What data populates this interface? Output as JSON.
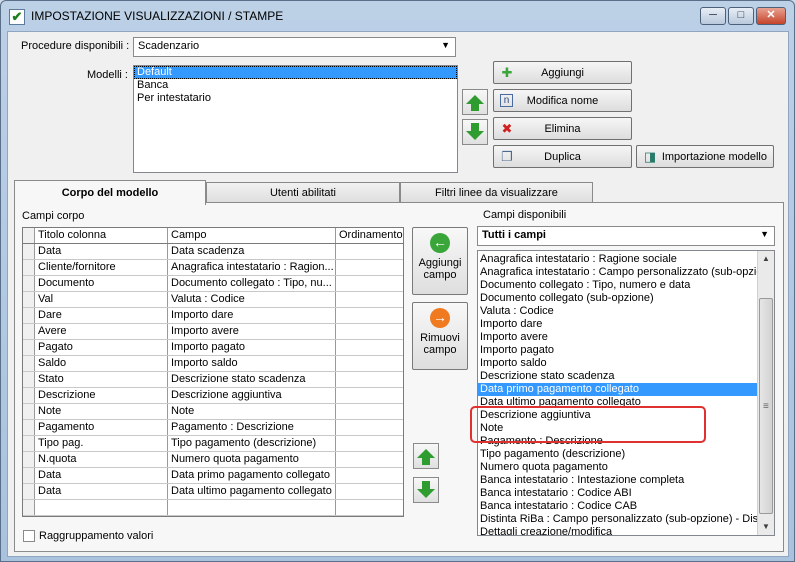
{
  "window": {
    "title": "IMPOSTAZIONE VISUALIZZAZIONI / STAMPE",
    "minimize": "─",
    "maximize": "□",
    "close": "✕"
  },
  "procedure": {
    "label": "Procedure disponibili :",
    "value": "Scadenzario"
  },
  "modelli": {
    "label": "Modelli :",
    "items": [
      "Default",
      "Banca",
      "Per intestatario"
    ],
    "selected_index": 0
  },
  "actions": {
    "aggiungi": "Aggiungi",
    "modifica_nome": "Modifica nome",
    "elimina": "Elimina",
    "duplica": "Duplica",
    "importazione": "Importazione modello"
  },
  "tabs": [
    "Corpo del modello",
    "Utenti abilitati",
    "Filtri linee da visualizzare"
  ],
  "active_tab_index": 0,
  "campi_corpo": {
    "label": "Campi corpo",
    "columns": [
      "Titolo colonna",
      "Campo",
      "Ordinamento"
    ],
    "rows": [
      [
        "Data",
        "Data scadenza",
        ""
      ],
      [
        "Cliente/fornitore",
        "Anagrafica intestatario : Ragion...",
        ""
      ],
      [
        "Documento",
        "Documento collegato : Tipo, nu...",
        ""
      ],
      [
        "Val",
        "Valuta : Codice",
        ""
      ],
      [
        "Dare",
        "Importo dare",
        ""
      ],
      [
        "Avere",
        "Importo avere",
        ""
      ],
      [
        "Pagato",
        "Importo pagato",
        ""
      ],
      [
        "Saldo",
        "Importo saldo",
        ""
      ],
      [
        "Stato",
        "Descrizione stato scadenza",
        ""
      ],
      [
        "Descrizione",
        "Descrizione aggiuntiva",
        ""
      ],
      [
        "Note",
        "Note",
        ""
      ],
      [
        "Pagamento",
        "Pagamento : Descrizione",
        ""
      ],
      [
        "Tipo pag.",
        "Tipo pagamento (descrizione)",
        ""
      ],
      [
        "N.quota",
        "Numero quota pagamento",
        ""
      ],
      [
        "Data",
        "Data primo pagamento collegato",
        ""
      ],
      [
        "Data",
        "Data ultimo pagamento collegato",
        ""
      ],
      [
        "",
        "",
        ""
      ]
    ]
  },
  "middle_buttons": {
    "aggiungi_campo": [
      "Aggiungi",
      "campo"
    ],
    "rimuovi_campo": [
      "Rimuovi",
      "campo"
    ]
  },
  "raggruppamento": {
    "label": "Raggruppamento valori",
    "checked": false
  },
  "campi_disponibili": {
    "label": "Campi disponibili",
    "filter": "Tutti i campi",
    "items": [
      "Anagrafica intestatario : Ragione sociale",
      "Anagrafica intestatario : Campo personalizzato (sub-opzione",
      "Documento collegato : Tipo, numero e data",
      "Documento collegato (sub-opzione)",
      "Valuta : Codice",
      "Importo dare",
      "Importo avere",
      "Importo pagato",
      "Importo saldo",
      "Descrizione stato scadenza",
      "Data primo pagamento collegato",
      "Data ultimo pagamento collegato",
      "Descrizione aggiuntiva",
      "Note",
      "Pagamento : Descrizione",
      "Tipo pagamento (descrizione)",
      "Numero quota pagamento",
      "Banca intestatario : Intestazione completa",
      "Banca intestatario : Codice ABI",
      "Banca intestatario : Codice CAB",
      "Distinta RiBa : Campo personalizzato (sub-opzione) - Distir",
      "Dettagli creazione/modifica"
    ],
    "selected_index": 10
  },
  "icons": {
    "check": "✔",
    "dropdown": "▼",
    "scroll_up": "▲",
    "scroll_down": "▼",
    "grip": "≡",
    "left_arrow": "←",
    "right_arrow": "→",
    "aggiungi_icon": "✚",
    "modifica_icon": "n",
    "elimina_icon": "✖",
    "duplica_icon": "❐",
    "import_icon": "◨"
  },
  "colors": {
    "selection": "#3399ff",
    "highlight_box": "#e03030",
    "arrow_green": "#2e9c2e",
    "add_green": "#3aa63a",
    "remove_orange": "#f07a20"
  }
}
